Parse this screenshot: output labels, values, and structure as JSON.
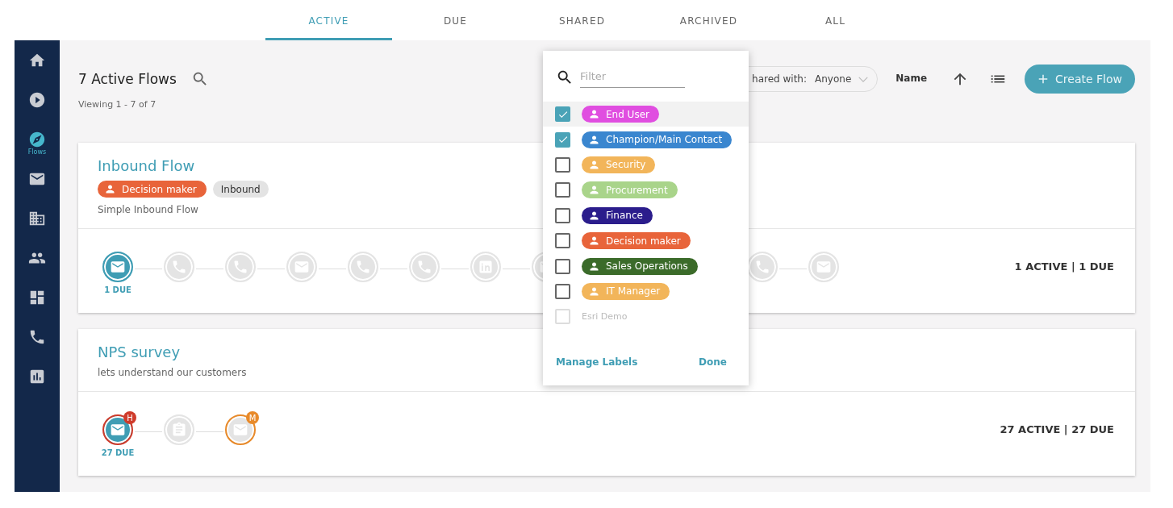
{
  "tabs": [
    {
      "label": "ACTIVE",
      "selected": true
    },
    {
      "label": "DUE",
      "selected": false
    },
    {
      "label": "SHARED",
      "selected": false
    },
    {
      "label": "ARCHIVED",
      "selected": false
    },
    {
      "label": "ALL",
      "selected": false
    }
  ],
  "sidebar": {
    "items": [
      {
        "kind": "home",
        "selected": false
      },
      {
        "kind": "play",
        "selected": false
      },
      {
        "kind": "compass",
        "label": "Flows",
        "selected": true
      },
      {
        "kind": "mail",
        "selected": false
      },
      {
        "kind": "building",
        "selected": false
      },
      {
        "kind": "people",
        "selected": false
      },
      {
        "kind": "dashboard",
        "selected": false
      },
      {
        "kind": "phone",
        "selected": false
      },
      {
        "kind": "chart",
        "selected": false
      }
    ]
  },
  "header": {
    "title": "7 Active Flows",
    "viewing": "Viewing 1 - 7 of 7",
    "shared_label": "hared with:",
    "shared_value": "Anyone",
    "sort_label": "Name",
    "create_button": "Create Flow"
  },
  "flows": [
    {
      "title": "Inbound Flow",
      "tags": [
        {
          "label": "Decision maker",
          "kind": "person",
          "color": "#e8643a"
        },
        {
          "label": "Inbound",
          "kind": "plain",
          "color": "#e3e3e3"
        }
      ],
      "description": "Simple Inbound Flow",
      "summary": "1 ACTIVE | 1 DUE",
      "steps": [
        {
          "kind": "mail",
          "active": true,
          "due": "1 DUE"
        },
        {
          "kind": "phone",
          "active": false
        },
        {
          "kind": "phone",
          "active": false
        },
        {
          "kind": "mail",
          "active": false
        },
        {
          "kind": "phone",
          "active": false
        },
        {
          "kind": "phone",
          "active": false
        },
        {
          "kind": "linkedin",
          "active": false
        },
        {
          "kind": "mail",
          "active": false
        },
        {
          "kind": "phone",
          "active": false,
          "gap_before": true
        },
        {
          "kind": "mail",
          "active": false
        }
      ]
    },
    {
      "title": "NPS survey",
      "description": "lets understand our customers",
      "summary": "27 ACTIVE | 27 DUE",
      "steps": [
        {
          "kind": "mail",
          "active": true,
          "due": "27 DUE",
          "badge": "H",
          "color": "#cf3b2b"
        },
        {
          "kind": "clipboard",
          "active": false
        },
        {
          "kind": "mail",
          "active": false,
          "badge": "M",
          "color": "#e88a2a"
        }
      ]
    }
  ],
  "label_menu": {
    "placeholder": "Filter",
    "labels": [
      {
        "name": "End User",
        "kind": "tag",
        "color": "#e04ee0",
        "checked": true,
        "highlighted": true,
        "disabled": false
      },
      {
        "name": "Champion/Main Contact",
        "kind": "tag",
        "color": "#3a86cf",
        "checked": true,
        "highlighted": false,
        "disabled": false
      },
      {
        "name": "Security",
        "kind": "tag",
        "color": "#f2b55a",
        "checked": false,
        "highlighted": false,
        "disabled": false
      },
      {
        "name": "Procurement",
        "kind": "tag",
        "color": "#a9d48a",
        "checked": false,
        "highlighted": false,
        "disabled": false
      },
      {
        "name": "Finance",
        "kind": "tag",
        "color": "#2b1d8c",
        "checked": false,
        "highlighted": false,
        "disabled": false
      },
      {
        "name": "Decision maker",
        "kind": "tag",
        "color": "#e8643a",
        "checked": false,
        "highlighted": false,
        "disabled": false
      },
      {
        "name": "Sales Operations",
        "kind": "tag",
        "color": "#3b6b2a",
        "checked": false,
        "highlighted": false,
        "disabled": false
      },
      {
        "name": "IT Manager",
        "kind": "tag",
        "color": "#f2b55a",
        "checked": false,
        "highlighted": false,
        "disabled": false
      },
      {
        "name": "Esri Demo",
        "kind": "plain",
        "checked": false,
        "highlighted": false,
        "disabled": true
      }
    ],
    "manage": "Manage Labels",
    "done": "Done"
  }
}
